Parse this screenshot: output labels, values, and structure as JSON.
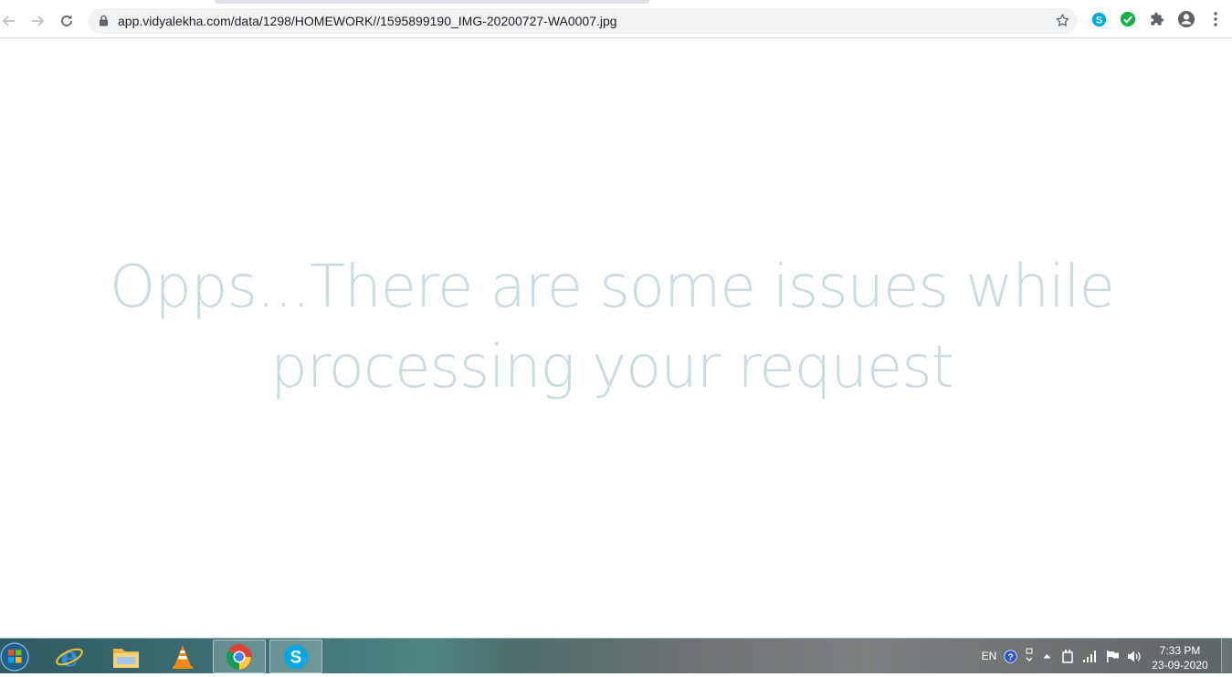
{
  "browser": {
    "url": "app.vidyalekha.com/data/1298/HOMEWORK//1595899190_IMG-20200727-WA0007.jpg",
    "icons": {
      "back": "back-arrow-icon",
      "forward": "forward-arrow-icon",
      "reload": "reload-icon",
      "lock": "lock-icon",
      "bookmark": "star-icon",
      "ext1": "skype-extension-icon",
      "ext2": "green-check-extension-icon",
      "extensions": "puzzle-icon",
      "profile": "profile-icon",
      "menu": "kebab-menu-icon"
    }
  },
  "page": {
    "message": "Opps...There are some issues while processing your request"
  },
  "taskbar": {
    "apps": [
      "Start",
      "Internet Explorer",
      "File Explorer",
      "VLC",
      "Google Chrome",
      "Skype"
    ],
    "active_app": "Google Chrome",
    "language": "EN",
    "time": "7:33 PM",
    "date": "23-09-2020"
  },
  "colors": {
    "message_text": "#c9dbe1",
    "omnibox_bg": "#f1f3f4",
    "skype_blue": "#00a9e5",
    "check_green": "#1bb04c"
  }
}
